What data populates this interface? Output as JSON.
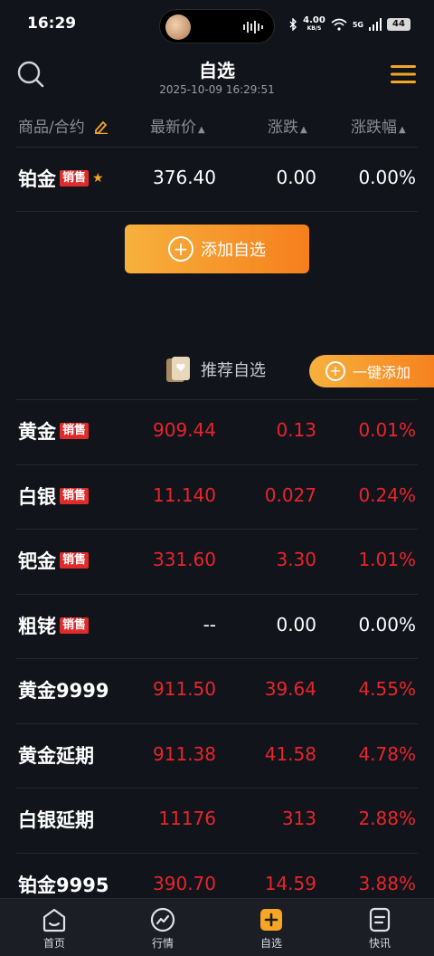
{
  "status_bar": {
    "time": "16:29",
    "net_speed_value": "4.00",
    "net_speed_unit": "KB/S",
    "network": "5G",
    "battery": "44"
  },
  "header": {
    "title": "自选",
    "datetime": "2025-10-09 16:29:51",
    "search_icon": "search-icon",
    "menu_icon": "menu-icon"
  },
  "columns": {
    "name": "商品/合约",
    "price": "最新价",
    "change": "涨跌",
    "change_pct": "涨跌幅"
  },
  "watchlist": [
    {
      "name": "铂金",
      "tag": "销售",
      "price": "376.40",
      "change": "0.00",
      "change_pct": "0.00%",
      "starred": true
    }
  ],
  "add_button": {
    "label": "添加自选"
  },
  "recommend": {
    "title": "推荐自选",
    "one_key_label": "一键添加"
  },
  "recommend_list": [
    {
      "name": "黄金",
      "tag": "销售",
      "price": "909.44",
      "change": "0.13",
      "change_pct": "0.01%"
    },
    {
      "name": "白银",
      "tag": "销售",
      "price": "11.140",
      "change": "0.027",
      "change_pct": "0.24%"
    },
    {
      "name": "钯金",
      "tag": "销售",
      "price": "331.60",
      "change": "3.30",
      "change_pct": "1.01%"
    },
    {
      "name": "粗铑",
      "tag": "销售",
      "price": "--",
      "change": "0.00",
      "change_pct": "0.00%"
    },
    {
      "name": "黄金9999",
      "tag": "",
      "price": "911.50",
      "change": "39.64",
      "change_pct": "4.55%"
    },
    {
      "name": "黄金延期",
      "tag": "",
      "price": "911.38",
      "change": "41.58",
      "change_pct": "4.78%"
    },
    {
      "name": "白银延期",
      "tag": "",
      "price": "11176",
      "change": "313",
      "change_pct": "2.88%"
    },
    {
      "name": "铂金9995",
      "tag": "",
      "price": "390.70",
      "change": "14.59",
      "change_pct": "3.88%"
    }
  ],
  "bottom_nav": [
    {
      "label": "首页",
      "icon": "home-icon"
    },
    {
      "label": "行情",
      "icon": "market-icon"
    },
    {
      "label": "自选",
      "icon": "watchlist-add-icon",
      "active": true
    },
    {
      "label": "快讯",
      "icon": "news-icon"
    }
  ],
  "colors": {
    "background": "#12141c",
    "accent": "#f5a623",
    "up": "#e8252a",
    "tag": "#e02b2b"
  }
}
